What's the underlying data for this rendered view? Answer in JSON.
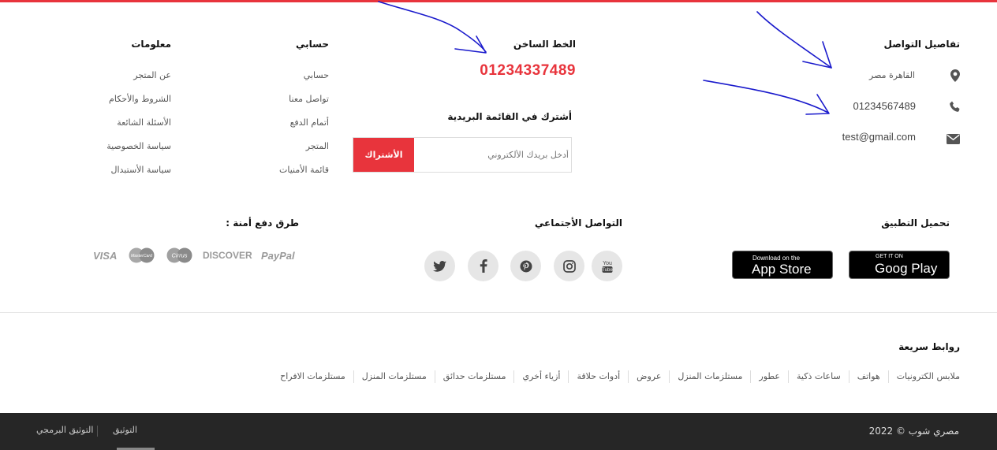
{
  "colors": {
    "accent": "#e8343c",
    "footer_bg": "#262626",
    "annotation_arrows": "#1a1acc"
  },
  "contact": {
    "title": "تفاصيل التواصل",
    "address": "القاهرة مصر",
    "phone": "01234567489",
    "email": "test@gmail.com",
    "icons": [
      "map-marker-icon",
      "phone-icon",
      "envelope-icon"
    ]
  },
  "hotline": {
    "title": "الخط الساخن",
    "number": "01234337489"
  },
  "newsletter": {
    "title": "أشترك في القائمة البريدية",
    "placeholder": "أدخل بريدك الألكتروني",
    "button": "الأشتراك"
  },
  "account": {
    "title": "حسابي",
    "links": [
      "حسابي",
      "تواصل معنا",
      "أتمام الدفع",
      "المتجر",
      "قائمة الأمنيات"
    ]
  },
  "info": {
    "title": "معلومات",
    "links": [
      "عن المتجر",
      "الشروط والأحكام",
      "الأسئلة الشائعة",
      "سياسة الخصوصية",
      "سياسة الأستبدال"
    ]
  },
  "app": {
    "title": "تحميل التطبيق",
    "google_play": {
      "small": "GET IT ON",
      "big": "Goog Play"
    },
    "app_store": {
      "small": "Download on the",
      "big": "App Store"
    }
  },
  "social": {
    "title": "التواصل الأجتماعي",
    "icons": [
      "youtube-icon",
      "instagram-icon",
      "pinterest-icon",
      "facebook-icon",
      "twitter-icon"
    ]
  },
  "payment": {
    "title": "طرق دفع أمنة :",
    "paypal": "PayPal",
    "discover": "DISCOVER",
    "cirrus": "Cirrus",
    "mastercard": "MasterCard",
    "visa": "VISA"
  },
  "quick_links": {
    "title": "روابط سريعة",
    "items": [
      "ملابس الكترونيات",
      "هواتف",
      "ساعات ذكية",
      "عطور",
      "مستلزمات المنزل",
      "عروض",
      "أدوات حلاقة",
      "أزياء أخري",
      "مستلزمات حدائق",
      "مستلزمات المنزل",
      "مستلزمات الافراح"
    ]
  },
  "bottom": {
    "copyright": "مصري شوب © 2022",
    "links": [
      "التوثيق",
      "التوثيق البرمجي"
    ]
  }
}
